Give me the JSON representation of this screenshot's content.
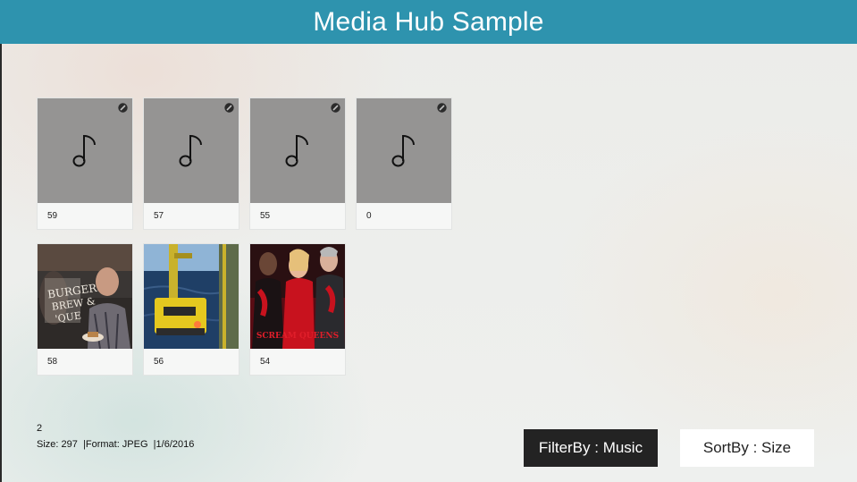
{
  "header": {
    "title": "Media Hub Sample"
  },
  "items": [
    {
      "label": "59",
      "type": "music",
      "icon": "music-note-icon"
    },
    {
      "label": "57",
      "type": "music",
      "icon": "music-note-icon"
    },
    {
      "label": "55",
      "type": "music",
      "icon": "music-note-icon"
    },
    {
      "label": "0",
      "type": "music",
      "icon": "music-note-icon"
    },
    {
      "label": "58",
      "type": "image",
      "description": "bald man at restaurant with Burgers Brew Que sign"
    },
    {
      "label": "56",
      "type": "image",
      "description": "yellow submersible over ocean"
    },
    {
      "label": "54",
      "type": "image",
      "description": "three women in red, show poster"
    }
  ],
  "status": {
    "count": "2",
    "size": "Size: 297",
    "format": "|Format: JPEG",
    "date": "|1/6/2016"
  },
  "buttons": {
    "filter_label": "FilterBy : Music",
    "sort_label": "SortBy : Size"
  },
  "colors": {
    "header_bg": "#2e93ae",
    "music_thumb_bg": "#959493",
    "filter_button_bg": "#232323",
    "sort_button_bg": "#ffffff"
  }
}
